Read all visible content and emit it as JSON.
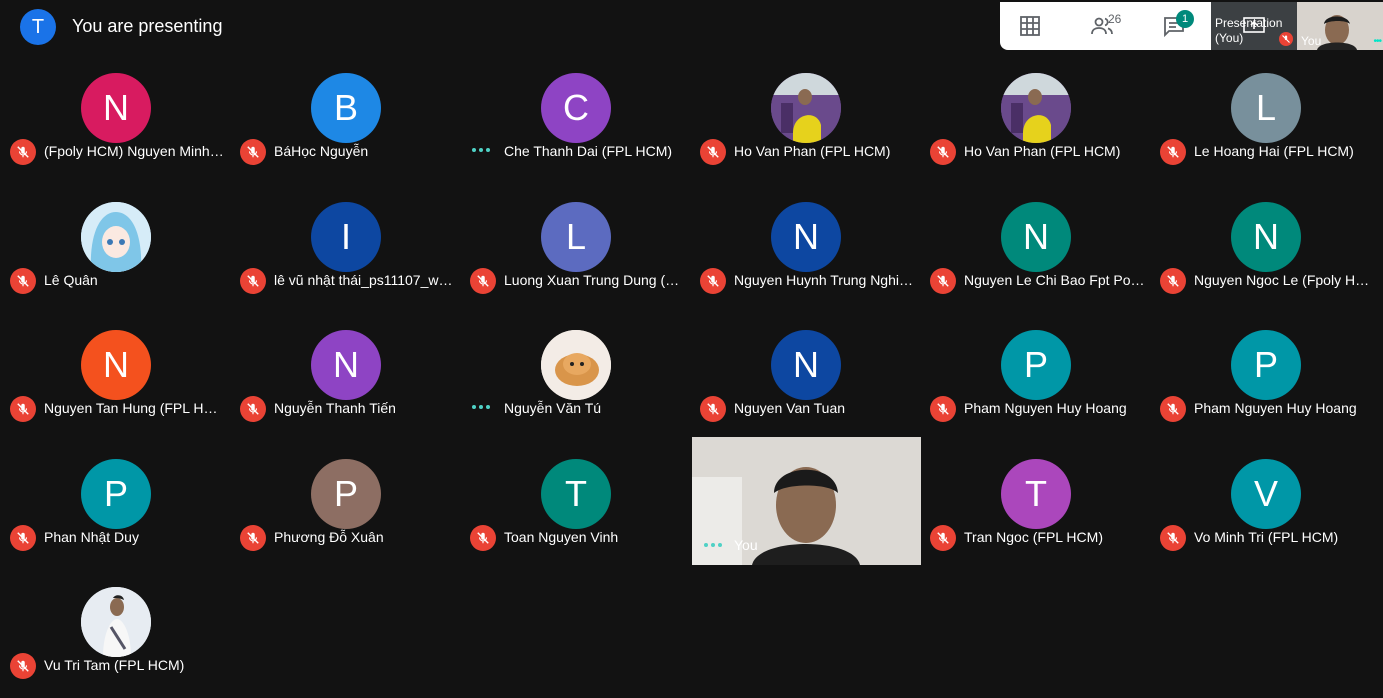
{
  "header": {
    "presenter_initial": "T",
    "status": "You are presenting"
  },
  "toolbar": {
    "participant_count": "26",
    "chat_badge": "1",
    "presentation_label": "Presentation (You)",
    "self_label": "You"
  },
  "participants": [
    {
      "initial": "N",
      "name": "(Fpoly HCM) Nguyen Minh C...",
      "color": "#d81b60",
      "status": "muted"
    },
    {
      "initial": "B",
      "name": "BáHọc Nguyễn",
      "color": "#1e88e5",
      "status": "muted"
    },
    {
      "initial": "C",
      "name": "Che Thanh Dai (FPL HCM)",
      "color": "#8e44c4",
      "status": "active"
    },
    {
      "initial": "",
      "name": "Ho Van Phan (FPL HCM)",
      "color": "#6a4a8c",
      "status": "muted",
      "photo": "person-purple-chair"
    },
    {
      "initial": "",
      "name": "Ho Van Phan (FPL HCM)",
      "color": "#6a4a8c",
      "status": "muted",
      "photo": "person-purple-chair"
    },
    {
      "initial": "L",
      "name": "Le Hoang Hai (FPL HCM)",
      "color": "#78909c",
      "status": "muted"
    },
    {
      "initial": "",
      "name": "Lê Quân",
      "color": "#b3d8f0",
      "status": "muted",
      "photo": "anime-avatar"
    },
    {
      "initial": "I",
      "name": "lê vũ nhật thái_ps11107_wd...",
      "color": "#0d47a1",
      "status": "muted"
    },
    {
      "initial": "L",
      "name": "Luong Xuan Trung Dung (FP...",
      "color": "#5c6bc0",
      "status": "muted"
    },
    {
      "initial": "N",
      "name": "Nguyen Huynh Trung Nghia ...",
      "color": "#0d47a1",
      "status": "muted"
    },
    {
      "initial": "N",
      "name": "Nguyen Le Chi Bao Fpt Polyt...",
      "color": "#00897b",
      "status": "muted"
    },
    {
      "initial": "N",
      "name": "Nguyen Ngoc Le (Fpoly HCM)",
      "color": "#00897b",
      "status": "muted"
    },
    {
      "initial": "N",
      "name": "Nguyen Tan Hung (FPL HCM)",
      "color": "#f4511e",
      "status": "muted"
    },
    {
      "initial": "N",
      "name": "Nguyễn Thanh Tiến",
      "color": "#8e44c4",
      "status": "muted"
    },
    {
      "initial": "",
      "name": "Nguyễn Văn Tú",
      "color": "#f0e6dc",
      "status": "active",
      "photo": "cat"
    },
    {
      "initial": "N",
      "name": "Nguyen Van Tuan",
      "color": "#0d47a1",
      "status": "muted"
    },
    {
      "initial": "P",
      "name": "Pham Nguyen Huy Hoang",
      "color": "#0097a7",
      "status": "muted"
    },
    {
      "initial": "P",
      "name": "Pham Nguyen Huy Hoang",
      "color": "#0097a7",
      "status": "muted"
    },
    {
      "initial": "P",
      "name": "Phan Nhật Duy",
      "color": "#0097a7",
      "status": "muted"
    },
    {
      "initial": "P",
      "name": "Phương Đỗ Xuân",
      "color": "#8d6e63",
      "status": "muted"
    },
    {
      "initial": "T",
      "name": "Toan Nguyen Vinh",
      "color": "#00897b",
      "status": "muted"
    },
    {
      "initial": "",
      "name": "You",
      "color": "#d9d6d0",
      "status": "active",
      "video": true
    },
    {
      "initial": "T",
      "name": "Tran Ngoc (FPL HCM)",
      "color": "#ab47bc",
      "status": "muted"
    },
    {
      "initial": "V",
      "name": "Vo Minh Tri (FPL HCM)",
      "color": "#0097a7",
      "status": "muted"
    },
    {
      "initial": "",
      "name": "Vu Tri Tam (FPL HCM)",
      "color": "#dfe6ef",
      "status": "muted",
      "photo": "man-standing"
    }
  ],
  "icons": {
    "grid": "grid-icon",
    "people": "people-icon",
    "chat": "chat-icon",
    "present": "present-screen-icon",
    "mic_off": "mic-off-icon",
    "speaking": "speaking-dots-icon"
  }
}
